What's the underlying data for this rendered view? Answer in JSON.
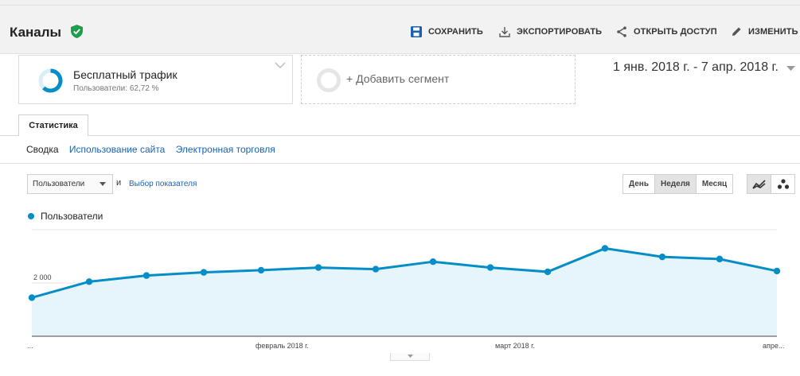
{
  "header": {
    "title": "Каналы",
    "actions": {
      "save": "СОХРАНИТЬ",
      "export": "ЭКСПОРТИРОВАТЬ",
      "share": "ОТКРЫТЬ ДОСТУП",
      "edit": "ИЗМЕНИТЬ"
    }
  },
  "segments": {
    "active": {
      "name": "Бесплатный трафик",
      "detail": "Пользователи: 62,72 %"
    },
    "add_label": "+ Добавить сегмент"
  },
  "date_range": "1 янв. 2018 г. - 7 апр. 2018 г.",
  "tabs": {
    "active": "Статистика"
  },
  "subnav": {
    "summary": "Сводка",
    "site_usage": "Использование сайта",
    "ecommerce": "Электронная торговля"
  },
  "controls": {
    "metric": "Пользователи",
    "and": "и",
    "pick_metric": "Выбор показателя",
    "periods": {
      "day": "День",
      "week": "Неделя",
      "month": "Месяц"
    },
    "selected_period": "week"
  },
  "colors": {
    "series": "#058dc7",
    "area": "#e6f4fb",
    "accent_green": "#1e9e4a",
    "save_blue": "#1a62b0"
  },
  "chart_data": {
    "type": "area",
    "legend": "Пользователи",
    "y_ticks": [
      "4 000",
      "2 000"
    ],
    "ylim": [
      0,
      4000
    ],
    "x_labels": [
      "...",
      "февраль 2018 г.",
      "март 2018 г.",
      "апре..."
    ],
    "series": [
      {
        "name": "Пользователи",
        "values": [
          1450,
          2050,
          2280,
          2400,
          2480,
          2580,
          2520,
          2800,
          2580,
          2420,
          3300,
          2980,
          2900,
          2450
        ]
      }
    ]
  }
}
